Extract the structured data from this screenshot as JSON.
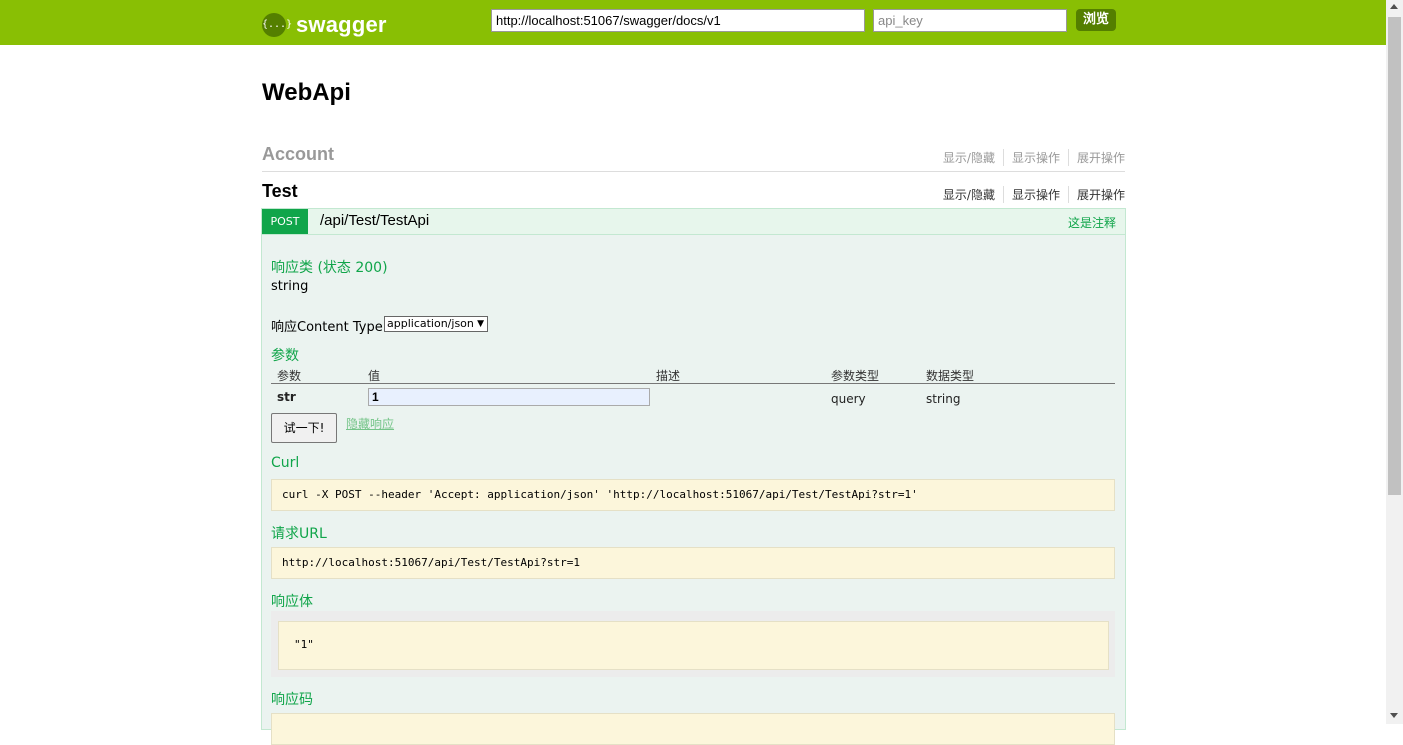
{
  "header": {
    "logo_glyph": "{...}",
    "logo_text": "swagger",
    "url_value": "http://localhost:51067/swagger/docs/v1",
    "api_key_placeholder": "api_key",
    "explore_label": "浏览",
    "colors": {
      "bar": "#89bf04",
      "button": "#547f00"
    }
  },
  "title": "WebApi",
  "resources": [
    {
      "name": "Account",
      "actions": [
        "显示/隐藏",
        "显示操作",
        "展开操作"
      ]
    },
    {
      "name": "Test",
      "actions": [
        "显示/隐藏",
        "显示操作",
        "展开操作"
      ]
    }
  ],
  "operation": {
    "method": "POST",
    "path": "/api/Test/TestApi",
    "note": "这是注释",
    "response_class_label": "响应类 (状态 200)",
    "response_class_type": "string",
    "content_type_label": "响应Content Type",
    "content_type_value": "application/json",
    "params_label": "参数",
    "param_columns": [
      "参数",
      "值",
      "描述",
      "参数类型",
      "数据类型"
    ],
    "params": [
      {
        "name": "str",
        "value": "1",
        "description": "",
        "param_type": "query",
        "data_type": "string"
      }
    ],
    "try_button": "试一下!",
    "hide_response": "隐藏响应",
    "curl_label": "Curl",
    "curl_value": "curl -X POST --header 'Accept: application/json' 'http://localhost:51067/api/Test/TestApi?str=1'",
    "request_url_label": "请求URL",
    "request_url_value": "http://localhost:51067/api/Test/TestApi?str=1",
    "response_body_label": "响应体",
    "response_body_value": "\"1\"",
    "response_code_label": "响应码",
    "colors": {
      "post": "#10a54a",
      "panel": "#ebf3f0",
      "code_bg": "#fcf6db"
    }
  }
}
